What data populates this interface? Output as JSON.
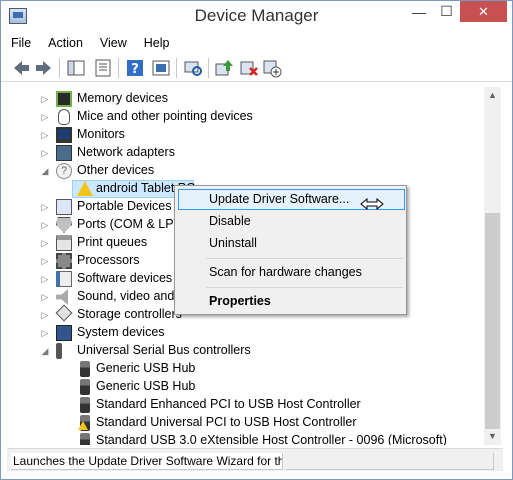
{
  "window": {
    "title": "Device Manager",
    "minimize_glyph": "—",
    "maximize_glyph": "☐",
    "close_glyph": "✕"
  },
  "menu": [
    "File",
    "Action",
    "View",
    "Help"
  ],
  "toolbar_icons": [
    "back-icon",
    "forward-icon",
    "show-hide-console-tree-icon",
    "properties-sheet-icon",
    "help-icon",
    "console-properties-icon",
    "scan-hardware-icon",
    "update-driver-icon",
    "uninstall-device-icon",
    "add-device-icon"
  ],
  "tree": [
    {
      "label": "Memory devices",
      "expander": "collapsed",
      "icon": "memory-icon"
    },
    {
      "label": "Mice and other pointing devices",
      "expander": "collapsed",
      "icon": "mouse-icon"
    },
    {
      "label": "Monitors",
      "expander": "collapsed",
      "icon": "monitor-icon"
    },
    {
      "label": "Network adapters",
      "expander": "collapsed",
      "icon": "network-icon"
    },
    {
      "label": "Other devices",
      "expander": "expanded",
      "icon": "other-devices-icon"
    },
    {
      "label": "android Tablet PC",
      "expander": "none",
      "icon": "warning-icon",
      "child": true,
      "selected": true
    },
    {
      "label": "Portable Devices",
      "expander": "collapsed",
      "icon": "portable-icon"
    },
    {
      "label": "Ports (COM & LPT)",
      "expander": "collapsed",
      "icon": "ports-icon"
    },
    {
      "label": "Print queues",
      "expander": "collapsed",
      "icon": "printer-icon"
    },
    {
      "label": "Processors",
      "expander": "collapsed",
      "icon": "processor-icon"
    },
    {
      "label": "Software devices",
      "expander": "collapsed",
      "icon": "software-icon"
    },
    {
      "label": "Sound, video and game controllers",
      "expander": "collapsed",
      "icon": "sound-icon"
    },
    {
      "label": "Storage controllers",
      "expander": "collapsed",
      "icon": "storage-icon"
    },
    {
      "label": "System devices",
      "expander": "collapsed",
      "icon": "system-icon"
    },
    {
      "label": "Universal Serial Bus controllers",
      "expander": "expanded",
      "icon": "usb-icon"
    },
    {
      "label": "Generic USB Hub",
      "expander": "none",
      "icon": "usb-plug-icon",
      "child": true
    },
    {
      "label": "Generic USB Hub",
      "expander": "none",
      "icon": "usb-plug-icon",
      "child": true
    },
    {
      "label": "Standard Enhanced PCI to USB Host Controller",
      "expander": "none",
      "icon": "usb-plug-icon",
      "child": true
    },
    {
      "label": "Standard Universal PCI to USB Host Controller",
      "expander": "none",
      "icon": "usb-warning-icon",
      "child": true
    },
    {
      "label": "Standard USB 3.0 eXtensible Host Controller - 0096 (Microsoft)",
      "expander": "none",
      "icon": "usb-plug-icon",
      "child": true
    }
  ],
  "context_menu": {
    "update_driver": "Update Driver Software...",
    "disable": "Disable",
    "uninstall": "Uninstall",
    "scan": "Scan for hardware changes",
    "properties": "Properties"
  },
  "status": {
    "text": "Launches the Update Driver Software Wizard for the selected device."
  },
  "colors": {
    "selection": "#cce8ff",
    "menu_hover": "#e5f1fb",
    "menu_hover_border": "#3399ff",
    "close_button": "#c75050"
  }
}
